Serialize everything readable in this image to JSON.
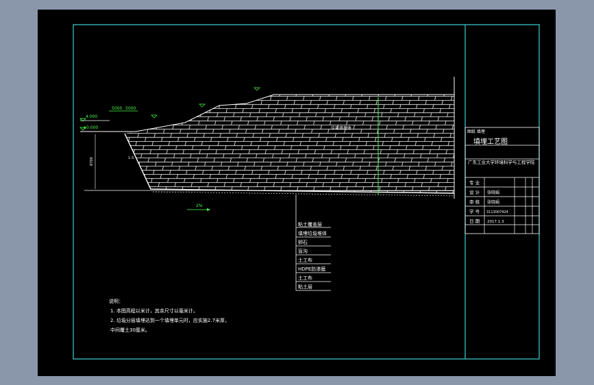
{
  "title_block": {
    "drawing_no": "图纸 填埋",
    "drawing_name": "填埋工艺图",
    "institution": "广东工业大学环境科学与工程学院",
    "rows": [
      {
        "label": "专 业",
        "value": ""
      },
      {
        "label": "设 计",
        "value": "张晓娟"
      },
      {
        "label": "审 核",
        "value": "张晓娟"
      },
      {
        "label": "学 号",
        "value": "3113007424"
      },
      {
        "label": "日 期",
        "value": "2017.1.3"
      }
    ]
  },
  "dimensions": {
    "elev_a": "4.000",
    "elev_b": "±0.000",
    "width_1": "5000",
    "width_2": "5000",
    "slope": "2%",
    "vertical": "8700",
    "slope_ratio": "1:3"
  },
  "labels": {
    "fill_body": "垃圾填埋体"
  },
  "layers": [
    "粘土覆盖层",
    "填埋垃圾堆体",
    "卵石",
    "盲沟",
    "土工布",
    "HDPE防渗膜",
    "土工布",
    "粘土层"
  ],
  "notes": {
    "heading": "说明：",
    "items": [
      "1.   本图高程以米计，其余尺寸以毫米计。",
      "2.   垃圾分层填埋达到一个填埋单元时，应实施2.7米厚，",
      "      中间覆土30厘米。"
    ]
  },
  "colors": {
    "frame": "#3fd0d0",
    "lines": "#ffffff",
    "accent": "#4cff4c"
  }
}
